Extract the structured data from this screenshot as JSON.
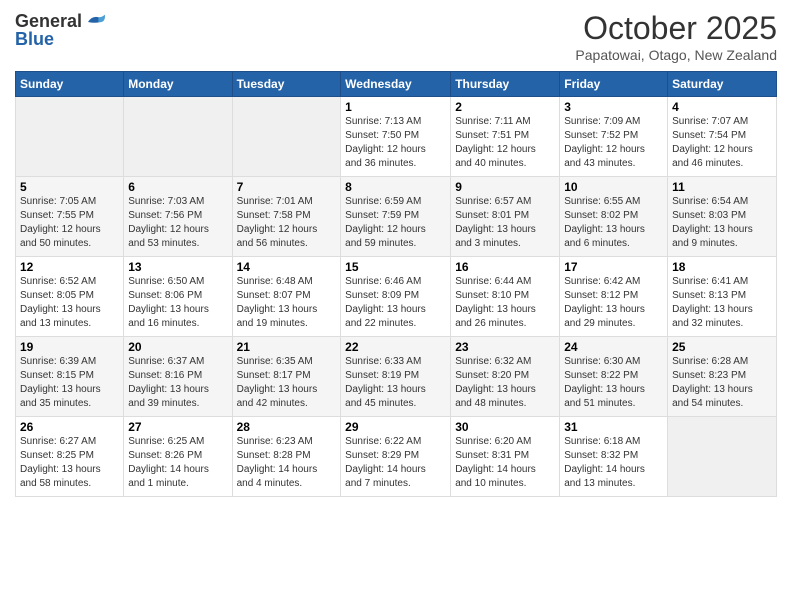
{
  "header": {
    "logo_general": "General",
    "logo_blue": "Blue",
    "month_title": "October 2025",
    "location": "Papatowai, Otago, New Zealand"
  },
  "days_of_week": [
    "Sunday",
    "Monday",
    "Tuesday",
    "Wednesday",
    "Thursday",
    "Friday",
    "Saturday"
  ],
  "weeks": [
    [
      {
        "day": "",
        "info": ""
      },
      {
        "day": "",
        "info": ""
      },
      {
        "day": "",
        "info": ""
      },
      {
        "day": "1",
        "info": "Sunrise: 7:13 AM\nSunset: 7:50 PM\nDaylight: 12 hours\nand 36 minutes."
      },
      {
        "day": "2",
        "info": "Sunrise: 7:11 AM\nSunset: 7:51 PM\nDaylight: 12 hours\nand 40 minutes."
      },
      {
        "day": "3",
        "info": "Sunrise: 7:09 AM\nSunset: 7:52 PM\nDaylight: 12 hours\nand 43 minutes."
      },
      {
        "day": "4",
        "info": "Sunrise: 7:07 AM\nSunset: 7:54 PM\nDaylight: 12 hours\nand 46 minutes."
      }
    ],
    [
      {
        "day": "5",
        "info": "Sunrise: 7:05 AM\nSunset: 7:55 PM\nDaylight: 12 hours\nand 50 minutes."
      },
      {
        "day": "6",
        "info": "Sunrise: 7:03 AM\nSunset: 7:56 PM\nDaylight: 12 hours\nand 53 minutes."
      },
      {
        "day": "7",
        "info": "Sunrise: 7:01 AM\nSunset: 7:58 PM\nDaylight: 12 hours\nand 56 minutes."
      },
      {
        "day": "8",
        "info": "Sunrise: 6:59 AM\nSunset: 7:59 PM\nDaylight: 12 hours\nand 59 minutes."
      },
      {
        "day": "9",
        "info": "Sunrise: 6:57 AM\nSunset: 8:01 PM\nDaylight: 13 hours\nand 3 minutes."
      },
      {
        "day": "10",
        "info": "Sunrise: 6:55 AM\nSunset: 8:02 PM\nDaylight: 13 hours\nand 6 minutes."
      },
      {
        "day": "11",
        "info": "Sunrise: 6:54 AM\nSunset: 8:03 PM\nDaylight: 13 hours\nand 9 minutes."
      }
    ],
    [
      {
        "day": "12",
        "info": "Sunrise: 6:52 AM\nSunset: 8:05 PM\nDaylight: 13 hours\nand 13 minutes."
      },
      {
        "day": "13",
        "info": "Sunrise: 6:50 AM\nSunset: 8:06 PM\nDaylight: 13 hours\nand 16 minutes."
      },
      {
        "day": "14",
        "info": "Sunrise: 6:48 AM\nSunset: 8:07 PM\nDaylight: 13 hours\nand 19 minutes."
      },
      {
        "day": "15",
        "info": "Sunrise: 6:46 AM\nSunset: 8:09 PM\nDaylight: 13 hours\nand 22 minutes."
      },
      {
        "day": "16",
        "info": "Sunrise: 6:44 AM\nSunset: 8:10 PM\nDaylight: 13 hours\nand 26 minutes."
      },
      {
        "day": "17",
        "info": "Sunrise: 6:42 AM\nSunset: 8:12 PM\nDaylight: 13 hours\nand 29 minutes."
      },
      {
        "day": "18",
        "info": "Sunrise: 6:41 AM\nSunset: 8:13 PM\nDaylight: 13 hours\nand 32 minutes."
      }
    ],
    [
      {
        "day": "19",
        "info": "Sunrise: 6:39 AM\nSunset: 8:15 PM\nDaylight: 13 hours\nand 35 minutes."
      },
      {
        "day": "20",
        "info": "Sunrise: 6:37 AM\nSunset: 8:16 PM\nDaylight: 13 hours\nand 39 minutes."
      },
      {
        "day": "21",
        "info": "Sunrise: 6:35 AM\nSunset: 8:17 PM\nDaylight: 13 hours\nand 42 minutes."
      },
      {
        "day": "22",
        "info": "Sunrise: 6:33 AM\nSunset: 8:19 PM\nDaylight: 13 hours\nand 45 minutes."
      },
      {
        "day": "23",
        "info": "Sunrise: 6:32 AM\nSunset: 8:20 PM\nDaylight: 13 hours\nand 48 minutes."
      },
      {
        "day": "24",
        "info": "Sunrise: 6:30 AM\nSunset: 8:22 PM\nDaylight: 13 hours\nand 51 minutes."
      },
      {
        "day": "25",
        "info": "Sunrise: 6:28 AM\nSunset: 8:23 PM\nDaylight: 13 hours\nand 54 minutes."
      }
    ],
    [
      {
        "day": "26",
        "info": "Sunrise: 6:27 AM\nSunset: 8:25 PM\nDaylight: 13 hours\nand 58 minutes."
      },
      {
        "day": "27",
        "info": "Sunrise: 6:25 AM\nSunset: 8:26 PM\nDaylight: 14 hours\nand 1 minute."
      },
      {
        "day": "28",
        "info": "Sunrise: 6:23 AM\nSunset: 8:28 PM\nDaylight: 14 hours\nand 4 minutes."
      },
      {
        "day": "29",
        "info": "Sunrise: 6:22 AM\nSunset: 8:29 PM\nDaylight: 14 hours\nand 7 minutes."
      },
      {
        "day": "30",
        "info": "Sunrise: 6:20 AM\nSunset: 8:31 PM\nDaylight: 14 hours\nand 10 minutes."
      },
      {
        "day": "31",
        "info": "Sunrise: 6:18 AM\nSunset: 8:32 PM\nDaylight: 14 hours\nand 13 minutes."
      },
      {
        "day": "",
        "info": ""
      }
    ]
  ]
}
